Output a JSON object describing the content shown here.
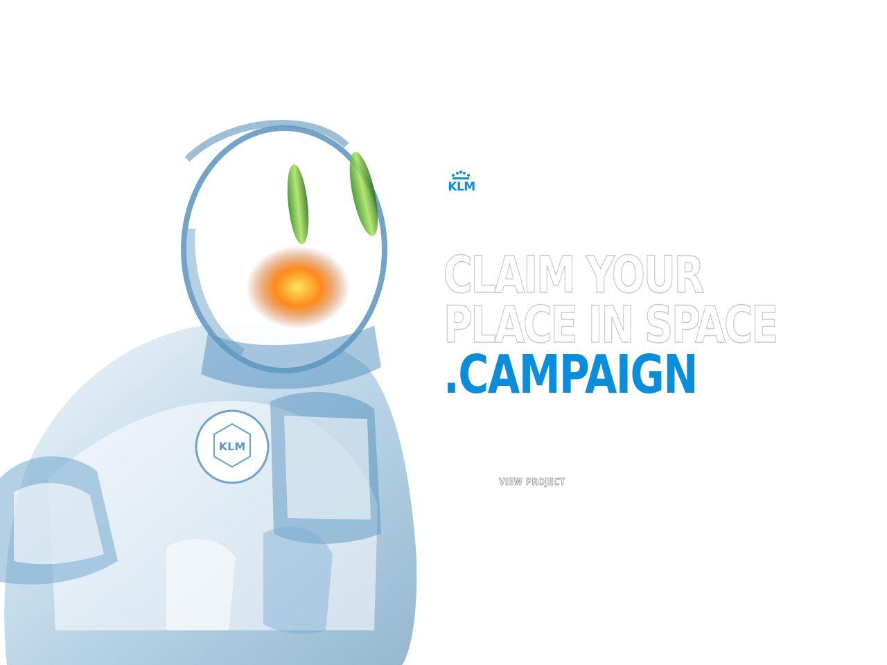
{
  "brand": {
    "logo_text": "KLM",
    "accent_color": "#0a8ddb"
  },
  "hero": {
    "title_line_1": "CLAIM YOUR",
    "title_line_2": "PLACE IN SPACE",
    "title_accent": ".CAMPAIGN",
    "image_icon": "astronaut-illustration",
    "patch_text": "KLM"
  },
  "cta": {
    "label": "VIEW PROJECT"
  }
}
